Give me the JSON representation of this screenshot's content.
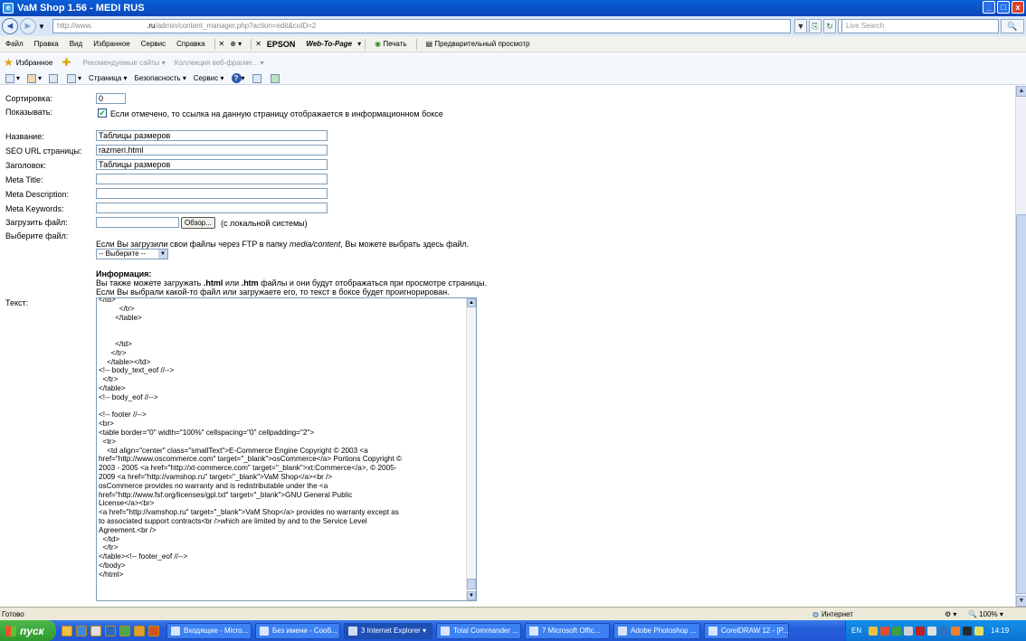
{
  "window": {
    "title": "VaM Shop 1.56 - MEDI RUS",
    "minimize": "_",
    "maximize": "□",
    "close": "x"
  },
  "address": {
    "prefix": "http://www.",
    "domain": ".ru",
    "path": "/admin/content_manager.php?action=edit&coID=2",
    "search_placeholder": "Live Search"
  },
  "menu": {
    "items": [
      "Файл",
      "Правка",
      "Вид",
      "Избранное",
      "Сервис",
      "Справка"
    ],
    "epson": "EPSON",
    "web_to_page": "Web-To-Page",
    "print": "Печать",
    "preview": "Предварительный просмотр"
  },
  "favorites": {
    "label": "Избранное",
    "suggested": "Рекомендуемые сайты",
    "webslice": "Коллекция веб-фрагме..."
  },
  "command": {
    "page": "Страница",
    "safety": "Безопасность",
    "tools": "Сервис",
    "help": "?"
  },
  "form": {
    "sort_label": "Сортировка:",
    "sort_value": "0",
    "show_label": "Показывать:",
    "show_text": "Если отмечено, то ссылка на данную страницу отображается в информационном боксе",
    "name_label": "Название:",
    "name_value": "Таблицы размеров",
    "seo_label": "SEO URL страницы:",
    "seo_value": "razmeri.html",
    "heading_label": "Заголовок:",
    "heading_value": "Таблицы размеров",
    "meta_title_label": "Meta Title:",
    "meta_desc_label": "Meta Description:",
    "meta_kw_label": "Meta Keywords:",
    "upload_label": "Загрузить файл:",
    "browse_button": "Обзор...",
    "local_system": "(с локальной системы)",
    "choose_label": "Выберите файл:",
    "ftp_text_before": "Если Вы загрузили свои файлы через FTP в папку ",
    "ftp_folder": "media/content",
    "ftp_text_after": ", Вы можете выбрать здесь файл.",
    "select_value": "-- Выберите --",
    "info_title": "Информация:",
    "info_line1_a": "Вы также можете загружать ",
    "info_html": ".html",
    "info_line1_b": " или ",
    "info_htm": ".htm",
    "info_line1_c": " файлы и они будут отображаться при просмотре страницы.",
    "info_line2": "Если Вы выбрали какой-то файл или загружаете его, то текст в боксе будет проигнорирован.",
    "text_label": "Текст:",
    "text_value": "</td>\n          </tr>\n        </table>\n\n\n        </td>\n      </tr>\n    </table></td>\n<!-- body_text_eof //-->\n  </tr>\n</table>\n<!-- body_eof //-->\n\n<!-- footer //-->\n<br>\n<table border=\"0\" width=\"100%\" cellspacing=\"0\" cellpadding=\"2\">\n  <tr>\n    <td align=\"center\" class=\"smallText\">E-Commerce Engine Copyright © 2003 <a\nhref=\"http://www.oscommerce.com\" target=\"_blank\">osCommerce</a> Portions Copyright ©\n2003 - 2005 <a href=\"http://xt-commerce.com\" target=\"_blank\">xt:Commerce</a>, © 2005-\n2009 <a href=\"http://vamshop.ru\" target=\"_blank\">VaM Shop</a><br />\nosCommerce provides no warranty and is redistributable under the <a\nhref=\"http://www.fsf.org/licenses/gpl.txt\" target=\"_blank\">GNU General Public\nLicense</a><br>\n<a href=\"http://vamshop.ru\" target=\"_blank\">VaM Shop</a> provides no warranty except as\nto associated support contracts<br />which are limited by and to the Service Level\nAgreement.<br />\n  </td>\n  </tr>\n</table><!-- footer_eof //-->\n</body>\n</html>"
  },
  "status": {
    "left": "Готово",
    "zone": "Интернет",
    "zoom": "100%"
  },
  "taskbar": {
    "start": "пуск",
    "tasks": [
      "Входящие - Micro...",
      "Без имени - Сооб...",
      "3 Internet Explorer",
      "Total Commander ...",
      "7 Microsoft Offic...",
      "Adobe Photoshop ...",
      "CorelDRAW 12 - [P..."
    ],
    "lang": "EN",
    "clock": "14:19"
  },
  "colors": {
    "titlebar": "#0a5fd8",
    "taskbar": "#245edb",
    "start": "#2e9a2e"
  }
}
